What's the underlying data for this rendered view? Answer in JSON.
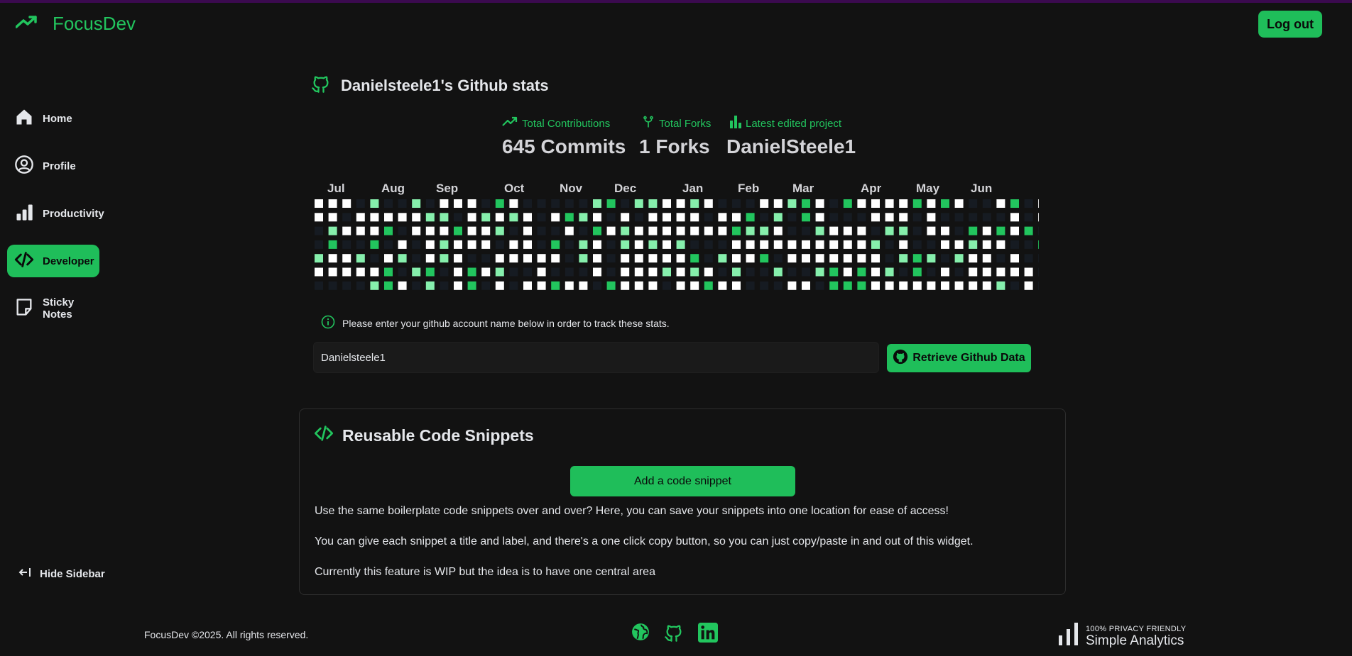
{
  "app": {
    "name": "FocusDev"
  },
  "header": {
    "logout_label": "Log out"
  },
  "sidebar": {
    "items": [
      {
        "label": "Home",
        "icon": "home-icon",
        "active": false
      },
      {
        "label": "Profile",
        "icon": "user-circle-icon",
        "active": false
      },
      {
        "label": "Productivity",
        "icon": "bar-chart-icon",
        "active": false
      },
      {
        "label": "Developer",
        "icon": "code-icon",
        "active": true
      },
      {
        "label": "Sticky Notes",
        "icon": "sticky-note-icon",
        "active": false
      }
    ],
    "hide_label": "Hide Sidebar"
  },
  "github": {
    "title": "Danielsteele1's Github stats",
    "stats": {
      "contributions_label": "Total Contributions",
      "forks_label": "Total Forks",
      "project_label": "Latest edited project",
      "contributions_value": "645 Commits",
      "forks_value": "1 Forks",
      "project_value": "DanielSteele1"
    },
    "months": [
      "Jul",
      "Aug",
      "Sep",
      "Oct",
      "Nov",
      "Dec",
      "Jan",
      "Feb",
      "Mar",
      "Apr",
      "May",
      "Jun"
    ],
    "heatmap_colors": [
      "#161b22",
      "#22c55e",
      "#86efac",
      "#ffffff"
    ],
    "info_text": "Please enter your github account name below in order to track these stats.",
    "username_value": "Danielsteele1",
    "retrieve_label": "Retrieve Github Data"
  },
  "snippets": {
    "title": "Reusable Code Snippets",
    "add_label": "Add a code snippet",
    "paragraphs": [
      "Use the same boilerplate code snippets over and over? Here, you can save your snippets into one location for ease of access!",
      "You can give each snippet a title and label, and there's a one click copy button, so you can just copy/paste in and out of this widget.",
      "Currently this feature is WIP but the idea is to have one central area"
    ]
  },
  "footer": {
    "copyright": "FocusDev ©2025. All rights reserved.",
    "analytics_tagline": "100% PRIVACY FRIENDLY",
    "analytics_name": "Simple Analytics"
  },
  "colors": {
    "accent": "#22c55e",
    "background": "#121212"
  }
}
